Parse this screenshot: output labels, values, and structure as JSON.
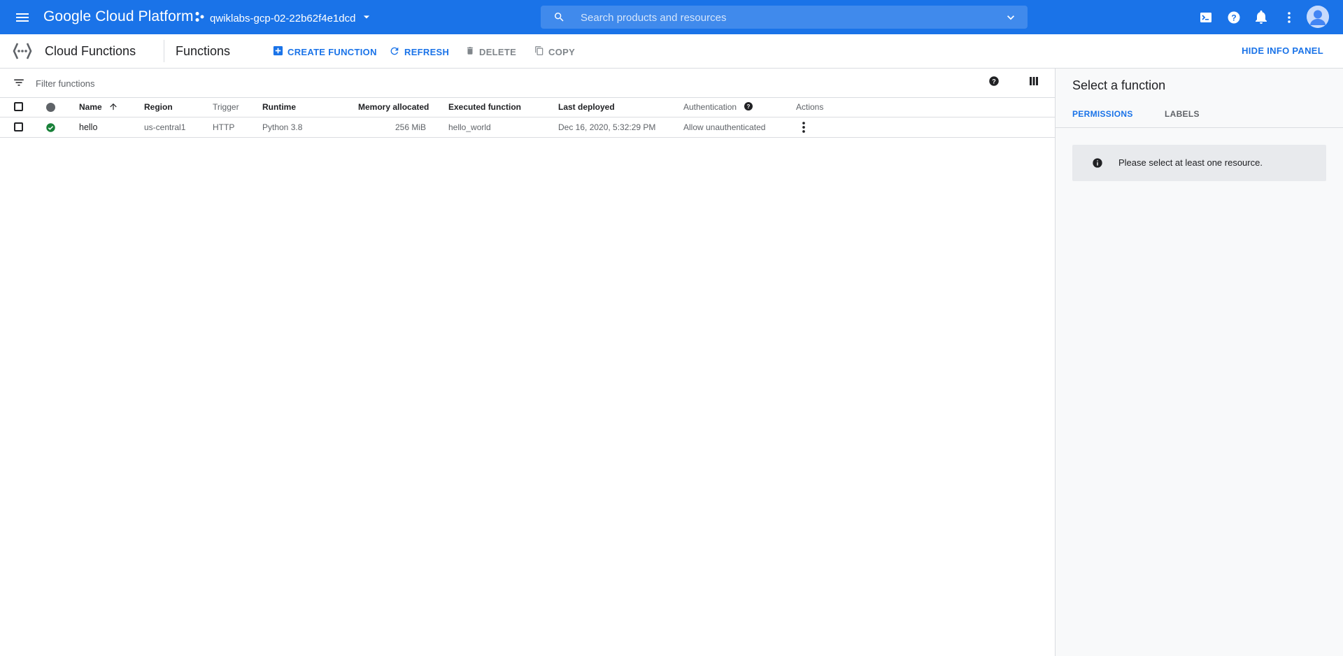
{
  "topbar": {
    "brand": "Google Cloud Platform",
    "project": "qwiklabs-gcp-02-22b62f4e1dcd",
    "search_placeholder": "Search products and resources",
    "icons": [
      "menu-icon",
      "project-icon",
      "search-icon",
      "chevron-down-icon",
      "cloud-shell-icon",
      "help-icon",
      "notifications-icon",
      "more-vert-icon",
      "avatar"
    ]
  },
  "subbar": {
    "product": "Cloud Functions",
    "page_title": "Functions",
    "actions": {
      "create": "CREATE FUNCTION",
      "refresh": "REFRESH",
      "delete": "DELETE",
      "copy": "COPY"
    },
    "hide_panel": "HIDE INFO PANEL"
  },
  "table": {
    "filter_placeholder": "Filter functions",
    "columns": {
      "name": "Name",
      "region": "Region",
      "trigger": "Trigger",
      "runtime": "Runtime",
      "memory": "Memory allocated",
      "executed": "Executed function",
      "last_deployed": "Last deployed",
      "auth": "Authentication",
      "actions": "Actions"
    },
    "rows": [
      {
        "name": "hello",
        "region": "us-central1",
        "trigger": "HTTP",
        "runtime": "Python 3.8",
        "memory": "256 MiB",
        "executed": "hello_world",
        "last_deployed": "Dec 16, 2020, 5:32:29 PM",
        "auth": "Allow unauthenticated",
        "status": "ok"
      }
    ]
  },
  "panel": {
    "title": "Select a function",
    "tabs": [
      "PERMISSIONS",
      "LABELS"
    ],
    "notice": "Please select at least one resource."
  },
  "colors": {
    "brand_blue": "#1a73e8",
    "status_ok": "#188038",
    "border": "#dadce0",
    "panel_bg": "#f8f9fa"
  }
}
